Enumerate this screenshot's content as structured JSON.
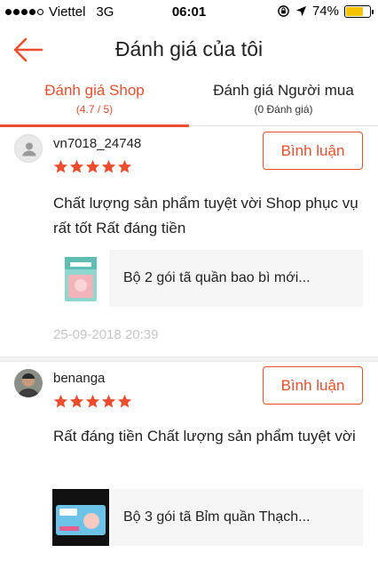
{
  "status_bar": {
    "carrier": "Viettel",
    "network": "3G",
    "time": "06:01",
    "battery": "74%",
    "battery_level": 0.74,
    "battery_color": "#f5c400"
  },
  "header": {
    "back_icon": "arrow-left-icon",
    "title": "Đánh giá của tôi",
    "accent_color": "#ee4d2d"
  },
  "tabs": [
    {
      "label": "Đánh giá Shop",
      "sub": "(4.7 / 5)",
      "active": true
    },
    {
      "label": "Đánh giá Người mua",
      "sub": "(0 Đánh giá)",
      "active": false
    }
  ],
  "reviews": [
    {
      "username": "vn7018_24748",
      "rating": 5,
      "button_label": "Bình luận",
      "text": "Chất lượng sản phẩm tuyệt vời Shop phục vụ rất tốt Rất đáng tiền",
      "product_name": "Bộ 2 gói tã quần bao bì mới...",
      "date": "25-09-2018 20:39"
    },
    {
      "username": "benanga",
      "rating": 5,
      "button_label": "Bình luận",
      "text": "Rất đáng tiền Chất lượng sản phẩm tuyệt vời",
      "product_name": "Bộ 3 gói tã Bỉm quần Thạch..."
    }
  ]
}
